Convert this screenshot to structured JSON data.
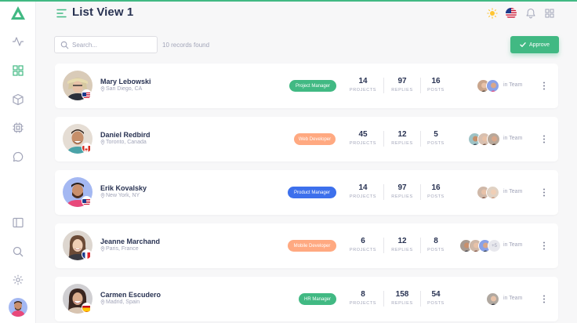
{
  "header": {
    "title": "List View 1"
  },
  "search": {
    "placeholder": "Search..."
  },
  "toolbar": {
    "records": "10 records found",
    "approve_label": "Approve"
  },
  "colors": {
    "accent": "#41b983",
    "blue": "#3d70ec",
    "orange": "#ffa981",
    "text": "#283252",
    "muted": "#a2a5b9"
  },
  "rows": [
    {
      "name": "Mary Lebowski",
      "location": "San Diego, CA",
      "role": "Project Manager",
      "role_color": "#41b983",
      "projects": "14",
      "replies": "97",
      "posts": "16",
      "team": "in Team",
      "flag": "us"
    },
    {
      "name": "Daniel Redbird",
      "location": "Toronto, Canada",
      "role": "Web Developer",
      "role_color": "#ffa981",
      "projects": "45",
      "replies": "12",
      "posts": "5",
      "team": "in Team",
      "flag": "ca"
    },
    {
      "name": "Erik Kovalsky",
      "location": "New York, NY",
      "role": "Product Manager",
      "role_color": "#3d70ec",
      "projects": "14",
      "replies": "97",
      "posts": "16",
      "team": "in Team",
      "flag": "us"
    },
    {
      "name": "Jeanne Marchand",
      "location": "Paris, France",
      "role": "Mobile Developer",
      "role_color": "#ffa981",
      "projects": "6",
      "replies": "12",
      "posts": "8",
      "team": "in Team",
      "more": "+5",
      "flag": "fr"
    },
    {
      "name": "Carmen Escudero",
      "location": "Madrid, Spain",
      "role": "HR Manager",
      "role_color": "#41b983",
      "projects": "8",
      "replies": "158",
      "posts": "54",
      "team": "in Team",
      "flag": "es"
    }
  ],
  "labels": {
    "projects": "PROJECTS",
    "replies": "REPLIES",
    "posts": "POSTS"
  }
}
